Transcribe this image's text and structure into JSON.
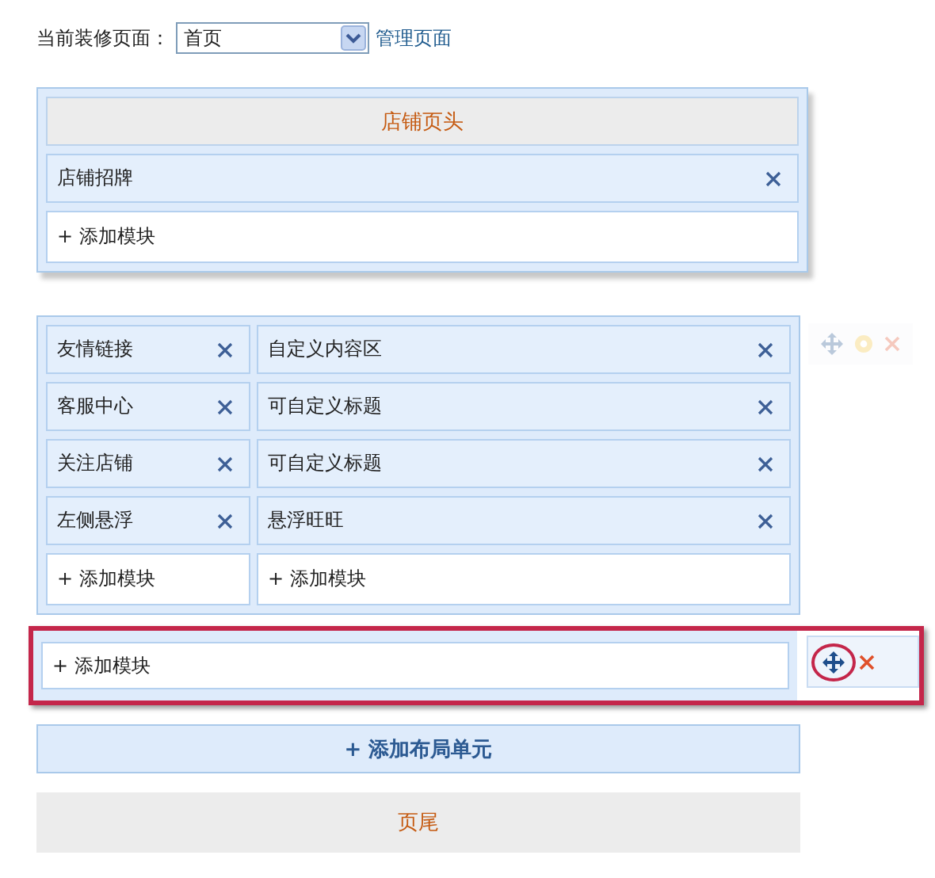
{
  "page_selector": {
    "label": "当前装修页面：",
    "value": "首页",
    "manage_link": "管理页面"
  },
  "header_section": {
    "title": "店铺页头",
    "modules": [
      {
        "name": "店铺招牌"
      }
    ],
    "add_module": "+ 添加模块"
  },
  "layout_section": {
    "columns": [
      {
        "modules": [
          {
            "name": "友情链接"
          },
          {
            "name": "客服中心"
          },
          {
            "name": "关注店铺"
          },
          {
            "name": "左侧悬浮"
          }
        ],
        "add_module": "+ 添加模块"
      },
      {
        "modules": [
          {
            "name": "自定义内容区"
          },
          {
            "name": "可自定义标题"
          },
          {
            "name": "可自定义标题"
          },
          {
            "name": "悬浮旺旺"
          }
        ],
        "add_module": "+ 添加模块"
      }
    ],
    "toolbar": {
      "active": false
    }
  },
  "highlighted_section": {
    "add_module": "+ 添加模块",
    "toolbar": {
      "active": true
    }
  },
  "add_layout_unit": "+ 添加布局单元",
  "footer": {
    "title": "页尾"
  }
}
